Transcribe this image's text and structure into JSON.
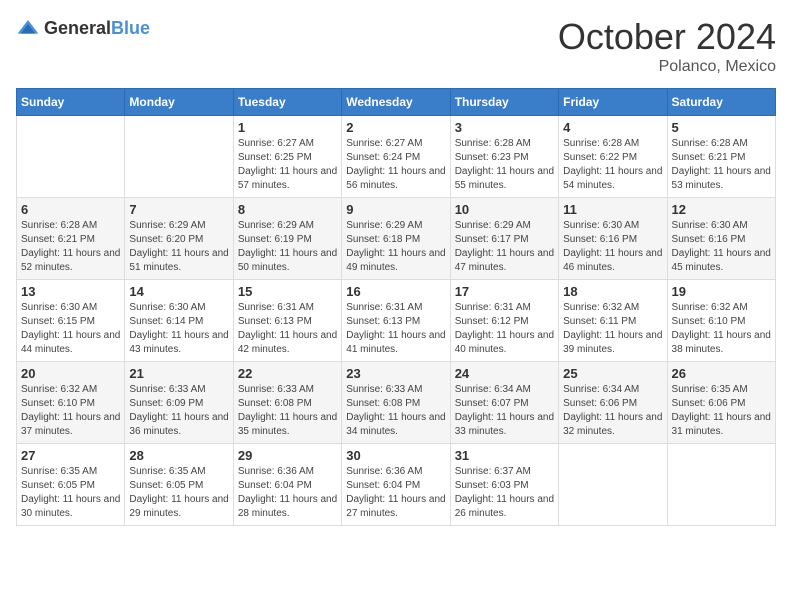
{
  "logo": {
    "text_general": "General",
    "text_blue": "Blue"
  },
  "title": {
    "month_year": "October 2024",
    "location": "Polanco, Mexico"
  },
  "weekdays": [
    "Sunday",
    "Monday",
    "Tuesday",
    "Wednesday",
    "Thursday",
    "Friday",
    "Saturday"
  ],
  "weeks": [
    [
      null,
      null,
      {
        "day": 1,
        "sunrise": "6:27 AM",
        "sunset": "6:25 PM",
        "daylight": "11 hours and 57 minutes."
      },
      {
        "day": 2,
        "sunrise": "6:27 AM",
        "sunset": "6:24 PM",
        "daylight": "11 hours and 56 minutes."
      },
      {
        "day": 3,
        "sunrise": "6:28 AM",
        "sunset": "6:23 PM",
        "daylight": "11 hours and 55 minutes."
      },
      {
        "day": 4,
        "sunrise": "6:28 AM",
        "sunset": "6:22 PM",
        "daylight": "11 hours and 54 minutes."
      },
      {
        "day": 5,
        "sunrise": "6:28 AM",
        "sunset": "6:21 PM",
        "daylight": "11 hours and 53 minutes."
      }
    ],
    [
      {
        "day": 6,
        "sunrise": "6:28 AM",
        "sunset": "6:21 PM",
        "daylight": "11 hours and 52 minutes."
      },
      {
        "day": 7,
        "sunrise": "6:29 AM",
        "sunset": "6:20 PM",
        "daylight": "11 hours and 51 minutes."
      },
      {
        "day": 8,
        "sunrise": "6:29 AM",
        "sunset": "6:19 PM",
        "daylight": "11 hours and 50 minutes."
      },
      {
        "day": 9,
        "sunrise": "6:29 AM",
        "sunset": "6:18 PM",
        "daylight": "11 hours and 49 minutes."
      },
      {
        "day": 10,
        "sunrise": "6:29 AM",
        "sunset": "6:17 PM",
        "daylight": "11 hours and 47 minutes."
      },
      {
        "day": 11,
        "sunrise": "6:30 AM",
        "sunset": "6:16 PM",
        "daylight": "11 hours and 46 minutes."
      },
      {
        "day": 12,
        "sunrise": "6:30 AM",
        "sunset": "6:16 PM",
        "daylight": "11 hours and 45 minutes."
      }
    ],
    [
      {
        "day": 13,
        "sunrise": "6:30 AM",
        "sunset": "6:15 PM",
        "daylight": "11 hours and 44 minutes."
      },
      {
        "day": 14,
        "sunrise": "6:30 AM",
        "sunset": "6:14 PM",
        "daylight": "11 hours and 43 minutes."
      },
      {
        "day": 15,
        "sunrise": "6:31 AM",
        "sunset": "6:13 PM",
        "daylight": "11 hours and 42 minutes."
      },
      {
        "day": 16,
        "sunrise": "6:31 AM",
        "sunset": "6:13 PM",
        "daylight": "11 hours and 41 minutes."
      },
      {
        "day": 17,
        "sunrise": "6:31 AM",
        "sunset": "6:12 PM",
        "daylight": "11 hours and 40 minutes."
      },
      {
        "day": 18,
        "sunrise": "6:32 AM",
        "sunset": "6:11 PM",
        "daylight": "11 hours and 39 minutes."
      },
      {
        "day": 19,
        "sunrise": "6:32 AM",
        "sunset": "6:10 PM",
        "daylight": "11 hours and 38 minutes."
      }
    ],
    [
      {
        "day": 20,
        "sunrise": "6:32 AM",
        "sunset": "6:10 PM",
        "daylight": "11 hours and 37 minutes."
      },
      {
        "day": 21,
        "sunrise": "6:33 AM",
        "sunset": "6:09 PM",
        "daylight": "11 hours and 36 minutes."
      },
      {
        "day": 22,
        "sunrise": "6:33 AM",
        "sunset": "6:08 PM",
        "daylight": "11 hours and 35 minutes."
      },
      {
        "day": 23,
        "sunrise": "6:33 AM",
        "sunset": "6:08 PM",
        "daylight": "11 hours and 34 minutes."
      },
      {
        "day": 24,
        "sunrise": "6:34 AM",
        "sunset": "6:07 PM",
        "daylight": "11 hours and 33 minutes."
      },
      {
        "day": 25,
        "sunrise": "6:34 AM",
        "sunset": "6:06 PM",
        "daylight": "11 hours and 32 minutes."
      },
      {
        "day": 26,
        "sunrise": "6:35 AM",
        "sunset": "6:06 PM",
        "daylight": "11 hours and 31 minutes."
      }
    ],
    [
      {
        "day": 27,
        "sunrise": "6:35 AM",
        "sunset": "6:05 PM",
        "daylight": "11 hours and 30 minutes."
      },
      {
        "day": 28,
        "sunrise": "6:35 AM",
        "sunset": "6:05 PM",
        "daylight": "11 hours and 29 minutes."
      },
      {
        "day": 29,
        "sunrise": "6:36 AM",
        "sunset": "6:04 PM",
        "daylight": "11 hours and 28 minutes."
      },
      {
        "day": 30,
        "sunrise": "6:36 AM",
        "sunset": "6:04 PM",
        "daylight": "11 hours and 27 minutes."
      },
      {
        "day": 31,
        "sunrise": "6:37 AM",
        "sunset": "6:03 PM",
        "daylight": "11 hours and 26 minutes."
      },
      null,
      null
    ]
  ]
}
